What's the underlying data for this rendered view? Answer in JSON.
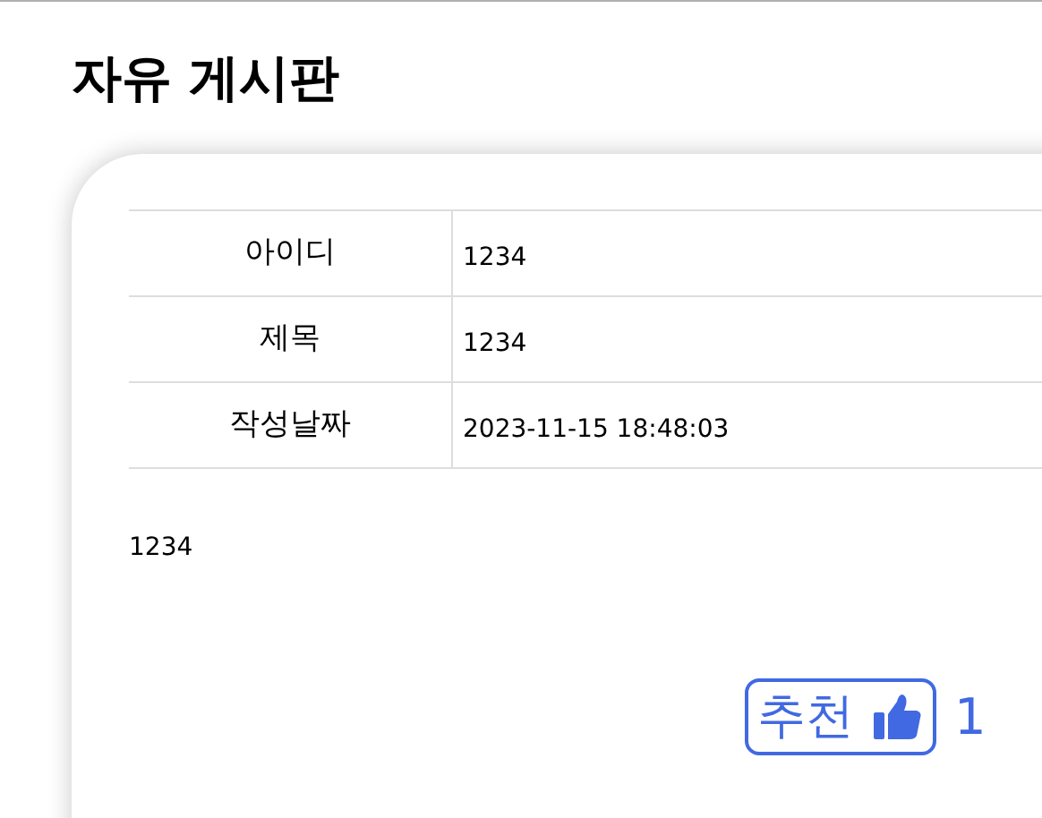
{
  "page_title": "자유 게시판",
  "fields": [
    {
      "label": "아이디",
      "value": "1234"
    },
    {
      "label": "제목",
      "value": "1234"
    },
    {
      "label": "작성날짜",
      "value": "2023-11-15 18:48:03"
    }
  ],
  "content": "1234",
  "recommend": {
    "label": "추천",
    "count": "1"
  }
}
